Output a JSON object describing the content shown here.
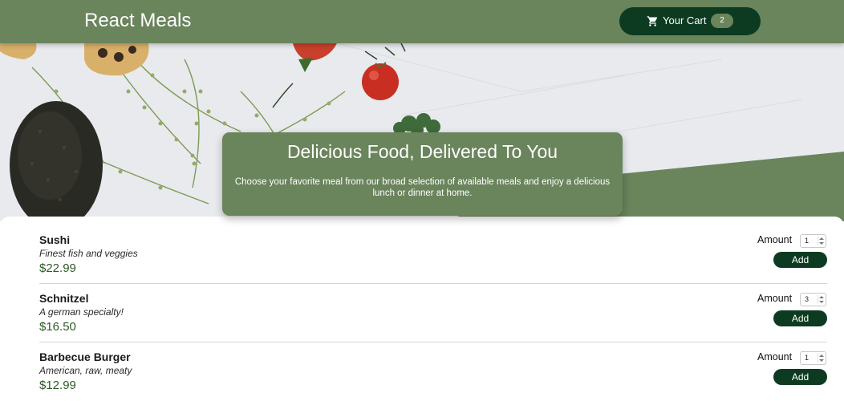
{
  "header": {
    "title": "React Meals",
    "cart": {
      "label": "Your Cart",
      "count": "2",
      "icon": "cart-icon"
    }
  },
  "summary": {
    "heading": "Delicious Food, Delivered To You",
    "text": "Choose your favorite meal from our broad selection of available meals and enjoy a delicious lunch or dinner at home."
  },
  "meals": [
    {
      "name": "Sushi",
      "description": "Finest fish and veggies",
      "price": "$22.99",
      "amount_label": "Amount",
      "amount": "1",
      "add_label": "Add"
    },
    {
      "name": "Schnitzel",
      "description": "A german specialty!",
      "price": "$16.50",
      "amount_label": "Amount",
      "amount": "3",
      "add_label": "Add"
    },
    {
      "name": "Barbecue Burger",
      "description": "American, raw, meaty",
      "price": "$12.99",
      "amount_label": "Amount",
      "amount": "1",
      "add_label": "Add"
    }
  ],
  "colors": {
    "primary_green": "#6a845c",
    "dark_green": "#0c3b22",
    "price_green": "#2d5a27"
  }
}
